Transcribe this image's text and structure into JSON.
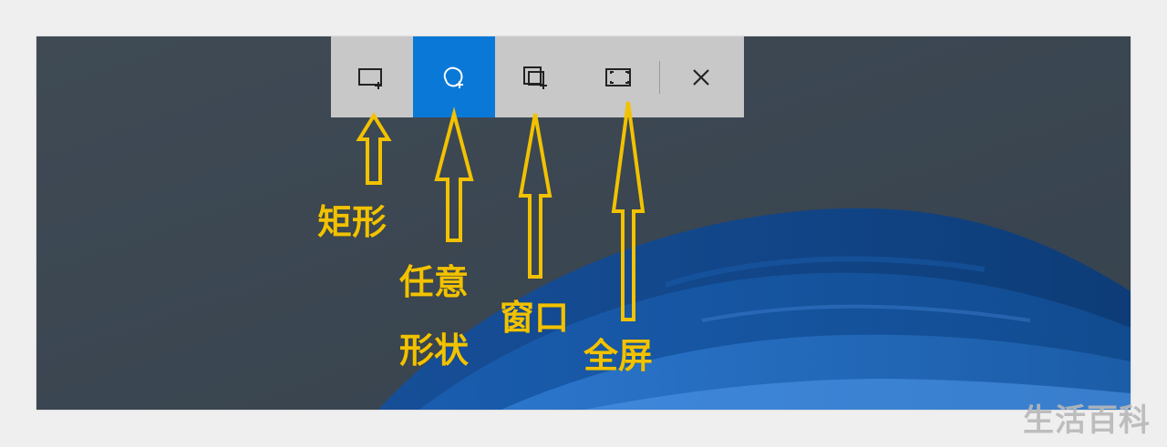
{
  "snip_toolbar": {
    "tools": [
      {
        "id": "rectangle",
        "icon": "rectangle-snip-icon",
        "active": false
      },
      {
        "id": "freeform",
        "icon": "freeform-snip-icon",
        "active": true
      },
      {
        "id": "window",
        "icon": "window-snip-icon",
        "active": false
      },
      {
        "id": "fullscreen",
        "icon": "fullscreen-snip-icon",
        "active": false
      }
    ],
    "close_icon": "close-icon",
    "accent_color": "#0a78d7",
    "toolbar_color": "#c8c8c8"
  },
  "annotations": {
    "rectangle_label": "矩形",
    "freeform_label_line1": "任意",
    "freeform_label_line2": "形状",
    "window_label": "窗口",
    "fullscreen_label": "全屏",
    "annotation_color": "#f2c200"
  },
  "watermark": {
    "text": "生活百科"
  },
  "wallpaper": {
    "base_color": "#3b4650",
    "wave_color": "#0f4c96"
  }
}
